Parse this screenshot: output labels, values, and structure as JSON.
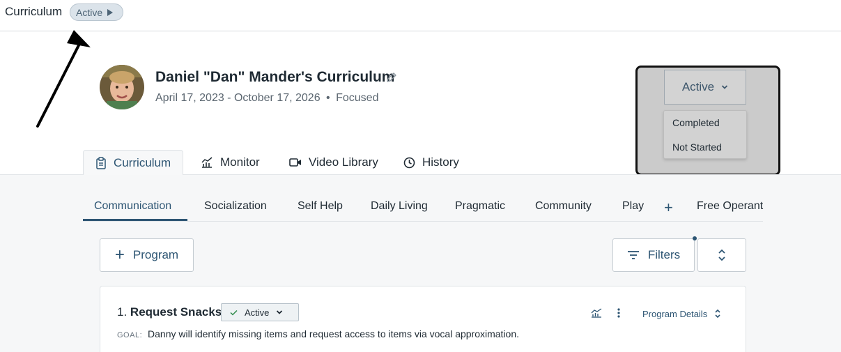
{
  "topbar": {
    "title": "Curriculum",
    "status_pill": "Active"
  },
  "learner": {
    "name": "Daniel \"Dan\" Mander's Curriculum",
    "dates": "April 17, 2023 - October 17, 2026",
    "mode": "Focused",
    "separator": "•"
  },
  "status_dropdown": {
    "selected": "Active",
    "options": [
      "Completed",
      "Not Started"
    ]
  },
  "main_tabs": [
    {
      "label": "Curriculum",
      "icon": "clipboard-icon",
      "active": true
    },
    {
      "label": "Monitor",
      "icon": "chart-icon",
      "active": false
    },
    {
      "label": "Video Library",
      "icon": "video-camera-icon",
      "active": false
    },
    {
      "label": "History",
      "icon": "clock-icon",
      "active": false
    }
  ],
  "domain_tabs": [
    {
      "label": "Communication",
      "active": true
    },
    {
      "label": "Socialization",
      "active": false
    },
    {
      "label": "Self Help",
      "active": false
    },
    {
      "label": "Daily Living",
      "active": false
    },
    {
      "label": "Pragmatic",
      "active": false
    },
    {
      "label": "Community",
      "active": false
    },
    {
      "label": "Play",
      "active": false
    },
    {
      "label": "+",
      "active": false
    },
    {
      "label": "Free Operant",
      "active": false
    }
  ],
  "toolbar": {
    "program_label": "Program",
    "filters_label": "Filters"
  },
  "program": {
    "number": "1.",
    "title": "Request Snacks",
    "status": "Active",
    "goal_label": "GOAL:",
    "goal_text": "Danny will identify missing items and request access to items via vocal approximation.",
    "details_label": "Program Details"
  },
  "colors": {
    "accent": "#2d5573",
    "content_bg": "#f6f7f8",
    "dropdown_bg": "#cbcbcb"
  }
}
